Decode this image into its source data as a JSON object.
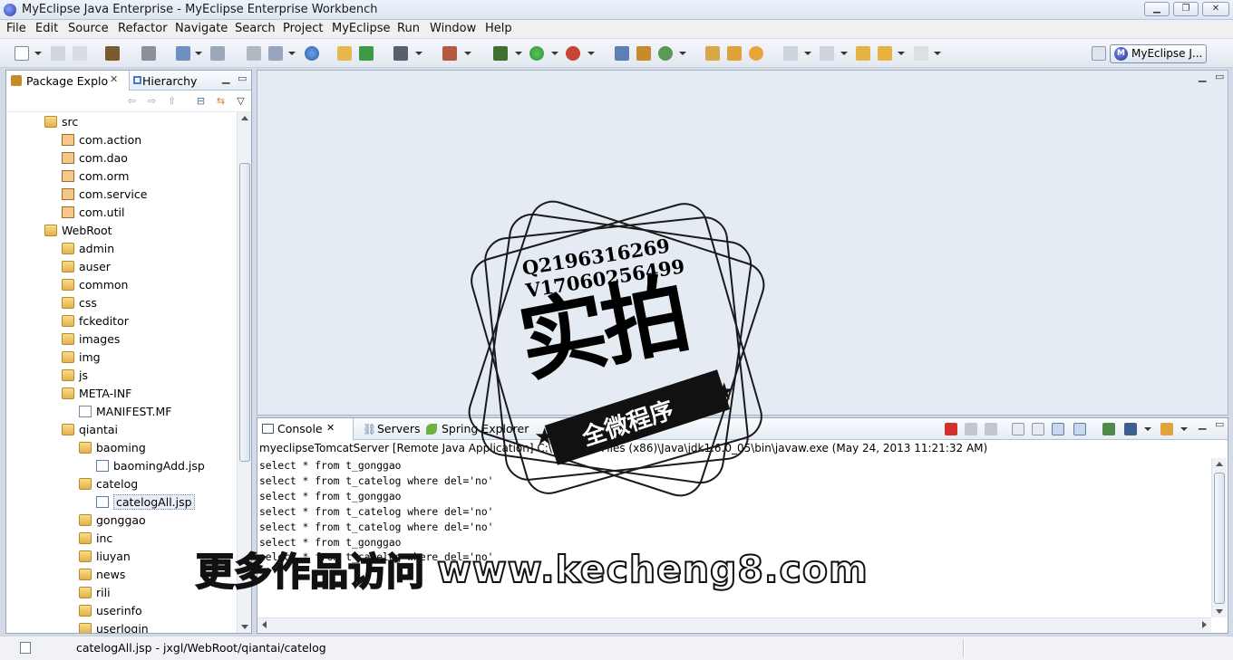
{
  "window": {
    "title": "MyEclipse Java Enterprise - MyEclipse Enterprise Workbench",
    "minimize_symbol": "▁",
    "restore_symbol": "❐",
    "close_symbol": "✕"
  },
  "menu": [
    "File",
    "Edit",
    "Source",
    "Refactor",
    "Navigate",
    "Search",
    "Project",
    "MyEclipse",
    "Run",
    "Window",
    "Help"
  ],
  "perspective": {
    "label": "MyEclipse J...",
    "icon_text": "M"
  },
  "explorer": {
    "tab_label": "Package Explo",
    "tab_close": "✕",
    "tab2_label": "Hierarchy",
    "tree": [
      {
        "label": "src",
        "icon": "source-folder-icon",
        "level": 0
      },
      {
        "label": "com.action",
        "icon": "package-icon",
        "level": 1
      },
      {
        "label": "com.dao",
        "icon": "package-icon",
        "level": 1
      },
      {
        "label": "com.orm",
        "icon": "package-icon",
        "level": 1
      },
      {
        "label": "com.service",
        "icon": "package-icon",
        "level": 1
      },
      {
        "label": "com.util",
        "icon": "package-icon",
        "level": 1
      },
      {
        "label": "WebRoot",
        "icon": "folder-icon",
        "level": 0
      },
      {
        "label": "admin",
        "icon": "folder-icon",
        "level": 1
      },
      {
        "label": "auser",
        "icon": "folder-icon",
        "level": 1
      },
      {
        "label": "common",
        "icon": "folder-icon",
        "level": 1
      },
      {
        "label": "css",
        "icon": "folder-icon",
        "level": 1
      },
      {
        "label": "fckeditor",
        "icon": "folder-icon",
        "level": 1
      },
      {
        "label": "images",
        "icon": "folder-icon",
        "level": 1
      },
      {
        "label": "img",
        "icon": "folder-icon",
        "level": 1
      },
      {
        "label": "js",
        "icon": "folder-icon",
        "level": 1
      },
      {
        "label": "META-INF",
        "icon": "folder-icon",
        "level": 1
      },
      {
        "label": "MANIFEST.MF",
        "icon": "file-icon",
        "level": 2
      },
      {
        "label": "qiantai",
        "icon": "folder-icon",
        "level": 1
      },
      {
        "label": "baoming",
        "icon": "folder-icon",
        "level": 2
      },
      {
        "label": "baomingAdd.jsp",
        "icon": "jsp-file-icon",
        "level": 3
      },
      {
        "label": "catelog",
        "icon": "folder-icon",
        "level": 2
      },
      {
        "label": "catelogAll.jsp",
        "icon": "jsp-file-icon",
        "level": 3,
        "selected": true
      },
      {
        "label": "gonggao",
        "icon": "folder-icon",
        "level": 2
      },
      {
        "label": "inc",
        "icon": "folder-icon",
        "level": 2
      },
      {
        "label": "liuyan",
        "icon": "folder-icon",
        "level": 2
      },
      {
        "label": "news",
        "icon": "folder-icon",
        "level": 2
      },
      {
        "label": "rili",
        "icon": "folder-icon",
        "level": 2
      },
      {
        "label": "userinfo",
        "icon": "folder-icon",
        "level": 2
      },
      {
        "label": "userlogin",
        "icon": "folder-icon",
        "level": 2
      }
    ]
  },
  "console": {
    "tabs": [
      {
        "label": "Console",
        "close": "✕"
      },
      {
        "label": "Servers"
      },
      {
        "label": "Spring Explorer"
      }
    ],
    "info": "myeclipseTomcatServer [Remote Java Application] C:\\Program Files (x86)\\Java\\jdk1.6.0_05\\bin\\javaw.exe (May 24, 2013 11:21:32 AM)",
    "output": [
      "select * from t_gonggao",
      "select * from t_catelog where del='no'",
      "select * from t_gonggao",
      "select * from t_catelog where del='no'",
      "select * from t_catelog where del='no'",
      "select * from t_gonggao",
      "select * from t_catelog where del='no'"
    ]
  },
  "status": {
    "text": "catelogAll.jsp - jxgl/WebRoot/qiantai/catelog"
  },
  "stamp": {
    "contact_q": "Q2196316269",
    "contact_v": "V17060256499",
    "big_text": "实拍",
    "ribbon_text": "全微程序"
  },
  "watermark": {
    "cn": "更多作品访问",
    "url": "www.kecheng8.com"
  },
  "colors": {
    "stop_red": "#d0312d",
    "run_green": "#2e9a3a",
    "package_brown": "#a7692c"
  }
}
